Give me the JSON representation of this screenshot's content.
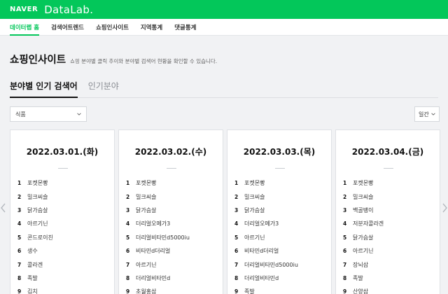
{
  "brand": {
    "naver": "NAVER",
    "datalab": "DataLab."
  },
  "nav": [
    {
      "label": "데이터랩 홈",
      "active": true
    },
    {
      "label": "검색어트렌드",
      "active": false
    },
    {
      "label": "쇼핑인사이트",
      "active": false
    },
    {
      "label": "지역통계",
      "active": false
    },
    {
      "label": "댓글통계",
      "active": false
    }
  ],
  "page": {
    "title": "쇼핑인사이트",
    "description": "쇼핑 분야별 클릭 추이와 분야별 검색어 현황을 확인할 수 있습니다."
  },
  "tabs": [
    {
      "label": "분야별 인기 검색어",
      "active": true
    },
    {
      "label": "인기분야",
      "active": false
    }
  ],
  "filters": {
    "category": "식품",
    "period": "일간"
  },
  "cards": [
    {
      "date": "2022.03.01.(화)",
      "ranks": [
        {
          "n": "1",
          "kw": "포켓몬빵"
        },
        {
          "n": "2",
          "kw": "밀크씨슬"
        },
        {
          "n": "3",
          "kw": "닭가슴살"
        },
        {
          "n": "4",
          "kw": "아르기닌"
        },
        {
          "n": "5",
          "kw": "콘드로이친"
        },
        {
          "n": "6",
          "kw": "생수"
        },
        {
          "n": "7",
          "kw": "콜라겐"
        },
        {
          "n": "8",
          "kw": "족발"
        },
        {
          "n": "9",
          "kw": "김치"
        }
      ]
    },
    {
      "date": "2022.03.02.(수)",
      "ranks": [
        {
          "n": "1",
          "kw": "포켓몬빵"
        },
        {
          "n": "2",
          "kw": "밀크씨슬"
        },
        {
          "n": "3",
          "kw": "닭가슴살"
        },
        {
          "n": "4",
          "kw": "더리얼오메가3"
        },
        {
          "n": "5",
          "kw": "더리얼비타민d5000iu"
        },
        {
          "n": "6",
          "kw": "비타민d더리얼"
        },
        {
          "n": "7",
          "kw": "아르기닌"
        },
        {
          "n": "8",
          "kw": "더리얼비타민d"
        },
        {
          "n": "9",
          "kw": "초월홍삼"
        }
      ]
    },
    {
      "date": "2022.03.03.(목)",
      "ranks": [
        {
          "n": "1",
          "kw": "포켓몬빵"
        },
        {
          "n": "2",
          "kw": "밀크씨슬"
        },
        {
          "n": "3",
          "kw": "닭가슴살"
        },
        {
          "n": "4",
          "kw": "더리얼오메가3"
        },
        {
          "n": "5",
          "kw": "아르기닌"
        },
        {
          "n": "6",
          "kw": "비타민d더리얼"
        },
        {
          "n": "7",
          "kw": "더리얼비타민d5000iu"
        },
        {
          "n": "8",
          "kw": "더리얼비타민d"
        },
        {
          "n": "9",
          "kw": "족발"
        }
      ]
    },
    {
      "date": "2022.03.04.(금)",
      "ranks": [
        {
          "n": "1",
          "kw": "포켓몬빵"
        },
        {
          "n": "2",
          "kw": "밀크씨슬"
        },
        {
          "n": "3",
          "kw": "백골뱅이"
        },
        {
          "n": "4",
          "kw": "저분자콜라겐"
        },
        {
          "n": "5",
          "kw": "닭가슴살"
        },
        {
          "n": "6",
          "kw": "아르기닌"
        },
        {
          "n": "7",
          "kw": "장뇌삼"
        },
        {
          "n": "8",
          "kw": "족발"
        },
        {
          "n": "9",
          "kw": "산양삼"
        }
      ]
    }
  ],
  "colors": {
    "brand_green": "#03c75a",
    "background": "#f1f2f4",
    "card": "#ffffff"
  },
  "icons": {
    "dropdown": "chevron-down-icon",
    "prev": "chevron-left-icon",
    "next": "chevron-right-icon"
  }
}
